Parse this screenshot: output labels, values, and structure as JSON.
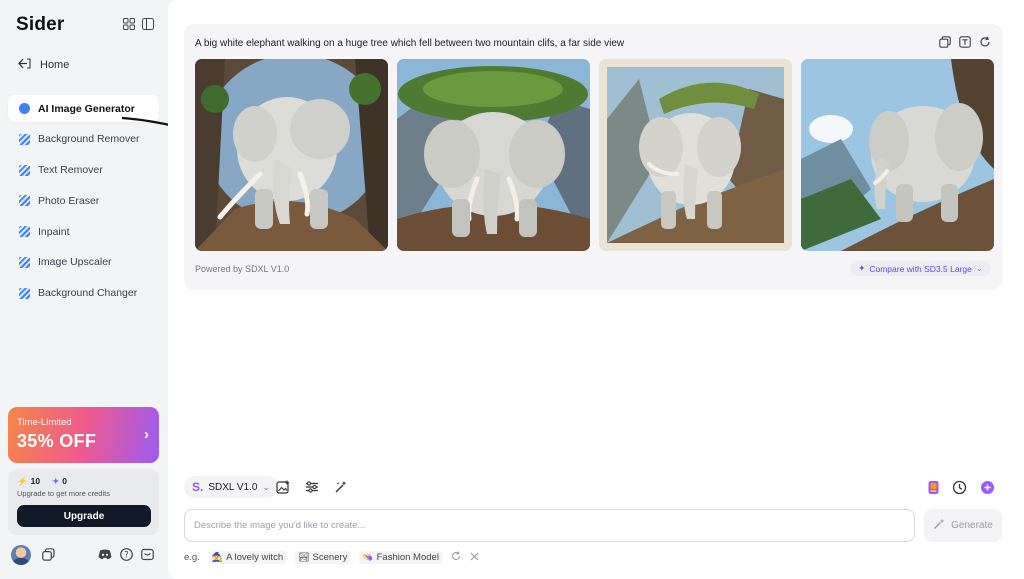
{
  "sidebar": {
    "brand": "Sider",
    "home_label": "Home",
    "items": [
      {
        "label": "AI Image Generator",
        "active": true
      },
      {
        "label": "Background Remover"
      },
      {
        "label": "Text Remover"
      },
      {
        "label": "Photo Eraser"
      },
      {
        "label": "Inpaint"
      },
      {
        "label": "Image Upscaler"
      },
      {
        "label": "Background Changer"
      }
    ],
    "promo": {
      "subtitle": "Time-Limited",
      "title": "35% OFF"
    },
    "credits": {
      "basic": "10",
      "advanced": "0",
      "note": "Upgrade to get more credits",
      "upgrade_label": "Upgrade"
    }
  },
  "main": {
    "prompt": "A big white elephant walking on a huge tree which fell between two mountain clifs, a far side view",
    "powered_by": "Powered by SDXL V1.0",
    "compare_label": "Compare with SD3.5 Large",
    "model_name": "SDXL V1.0",
    "input_placeholder": "Describe the image you'd like to create...",
    "generate_label": "Generate",
    "examples_prefix": "e.g.",
    "examples": [
      "A lovely witch",
      "Scenery",
      "Fashion Model"
    ]
  }
}
